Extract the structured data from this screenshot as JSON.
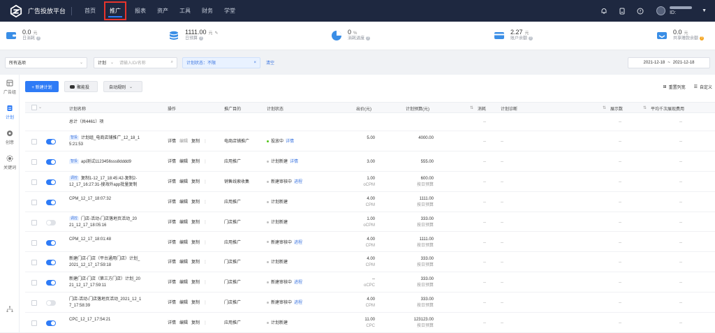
{
  "topbar": {
    "brand": "广告投放平台",
    "nav": [
      {
        "label": "首页",
        "active": false
      },
      {
        "label": "推广",
        "active": true
      },
      {
        "label": "报表",
        "active": false
      },
      {
        "label": "资产",
        "active": false
      },
      {
        "label": "工具",
        "active": false
      },
      {
        "label": "财务",
        "active": false
      },
      {
        "label": "学堂",
        "active": false
      }
    ],
    "user_id_prefix": "ID:"
  },
  "stats": [
    {
      "value": "0.0",
      "unit": "元",
      "label": "日消耗",
      "icon": "wallet-icon",
      "color": "#3a8ee6"
    },
    {
      "value": "1111.00",
      "unit": "元",
      "label": "日预算",
      "icon": "coins-icon",
      "color": "#3a8ee6"
    },
    {
      "value": "0",
      "unit": "%",
      "label": "消耗进度",
      "icon": "pie-chart-icon",
      "color": "#3a8ee6"
    },
    {
      "value": "2.27",
      "unit": "元",
      "label": "账户余额",
      "icon": "card-icon",
      "color": "#3a8ee6"
    },
    {
      "value": "0.0",
      "unit": "元",
      "label": "共享赠款余额",
      "icon": "gift-card-icon",
      "color": "#3a8ee6"
    }
  ],
  "filters": {
    "scope": "所有选项",
    "level": "计划",
    "search_placeholder": "请输入ID/名称",
    "status_tag": "计划状态：不限",
    "clear": "清空",
    "date_start": "2021-12-18",
    "date_sep": "~",
    "date_end": "2021-12-18"
  },
  "sidebar": [
    {
      "label": "广告组",
      "active": false
    },
    {
      "label": "计划",
      "active": true
    },
    {
      "label": "创意",
      "active": false
    },
    {
      "label": "关键词",
      "active": false
    }
  ],
  "toolbar": {
    "new_plan": "+ 新建计划",
    "smart": "聚能投",
    "auto_rule": "自动规则",
    "reset_width": "重置列宽",
    "customize": "自定义"
  },
  "table": {
    "headers": {
      "name": "计划名称",
      "ops": "操作",
      "purpose": "推广目的",
      "status": "计划状态",
      "bid": "出价(元)",
      "budget": "计划预算(元)",
      "cost": "消耗",
      "diagnosis": "计划诊断",
      "impressions": "展示数",
      "cpm": "平均千次展现费用"
    },
    "total": "总计（共4461）项",
    "dash": "--",
    "ops_labels": {
      "detail": "详情",
      "edit": "编辑",
      "copy": "复制",
      "more": "⋮"
    },
    "rows": [
      {
        "on": true,
        "badge": "智投",
        "name1": "计划组_电商店铺推广_12_18_1",
        "name2": "5:21:53",
        "purpose": "电商店铺推广",
        "status": "投放中",
        "status_color": "#52c41a",
        "status_link": "详情",
        "bid": "5.00",
        "bid_sub": "",
        "budget": "4000.00",
        "budget_sub": "",
        "edit_muted": true
      },
      {
        "on": true,
        "badge": "智投",
        "name1": "api测试1123456sss8dddd9",
        "name2": "",
        "purpose": "应用推广",
        "status": "计划新建",
        "status_color": "#bfbfbf",
        "status_link": "详情",
        "bid": "3.00",
        "bid_sub": "",
        "budget": "555.00",
        "budget_sub": "",
        "edit_muted": false
      },
      {
        "on": true,
        "badge": "调控",
        "name1": "复制1-12_17_18:45:42-复制2-",
        "name2": "12_17_16:27:31-搜海外app批量复制",
        "purpose": "销售线索收集",
        "status": "新建审核中",
        "status_color": "#bfbfbf",
        "status_link": "进程",
        "bid": "1.00",
        "bid_sub": "oCPM",
        "budget": "600.00",
        "budget_sub": "按日预算",
        "edit_muted": false
      },
      {
        "on": true,
        "badge": "",
        "name1": "CPM_12_17_18:07:32",
        "name2": "",
        "purpose": "应用推广",
        "status": "计划新建",
        "status_color": "#bfbfbf",
        "status_link": "",
        "bid": "4.00",
        "bid_sub": "CPM",
        "budget": "1111.00",
        "budget_sub": "按日预算",
        "edit_muted": false
      },
      {
        "on": false,
        "badge": "调控",
        "name1": "门店-活动-门店落地页活动_20",
        "name2": "21_12_17_18:05:16",
        "purpose": "门店推广",
        "status": "计划新建",
        "status_color": "#bfbfbf",
        "status_link": "",
        "bid": "1.00",
        "bid_sub": "oCPM",
        "budget": "333.00",
        "budget_sub": "按日预算",
        "edit_muted": false
      },
      {
        "on": true,
        "badge": "",
        "name1": "CPM_12_17_18:01:48",
        "name2": "",
        "purpose": "应用推广",
        "status": "新建审核中",
        "status_color": "#bfbfbf",
        "status_link": "进程",
        "bid": "4.00",
        "bid_sub": "CPM",
        "budget": "1111.00",
        "budget_sub": "按日预算",
        "edit_muted": false
      },
      {
        "on": true,
        "badge": "",
        "name1": "新建门店-门店（平台通用门店）计划_",
        "name2": "2021_12_17_17:59:18",
        "purpose": "门店推广",
        "status": "计划新建",
        "status_color": "#bfbfbf",
        "status_link": "",
        "bid": "4.00",
        "bid_sub": "CPM",
        "budget": "333.00",
        "budget_sub": "按日预算",
        "edit_muted": false
      },
      {
        "on": true,
        "badge": "",
        "name1": "新建门店-门店（第三方门店）计划_20",
        "name2": "21_12_17_17:59:11",
        "purpose": "门店推广",
        "status": "新建审核中",
        "status_color": "#bfbfbf",
        "status_link": "进程",
        "bid": "--",
        "bid_sub": "oCPC",
        "budget": "333.00",
        "budget_sub": "按日预算",
        "edit_muted": false
      },
      {
        "on": false,
        "badge": "",
        "name1": "门店-活动-门店落地页活动_2021_12_1",
        "name2": "7_17:58:39",
        "purpose": "门店推广",
        "status": "新建审核中",
        "status_color": "#bfbfbf",
        "status_link": "进程",
        "bid": "4.00",
        "bid_sub": "CPM",
        "budget": "333.00",
        "budget_sub": "按日预算",
        "edit_muted": false
      },
      {
        "on": true,
        "badge": "",
        "name1": "CPC_12_17_17:54:21",
        "name2": "",
        "purpose": "应用推广",
        "status": "计划新建",
        "status_color": "#bfbfbf",
        "status_link": "",
        "bid": "11.00",
        "bid_sub": "CPC",
        "budget": "123123.00",
        "budget_sub": "按日预算",
        "edit_muted": false
      }
    ]
  }
}
